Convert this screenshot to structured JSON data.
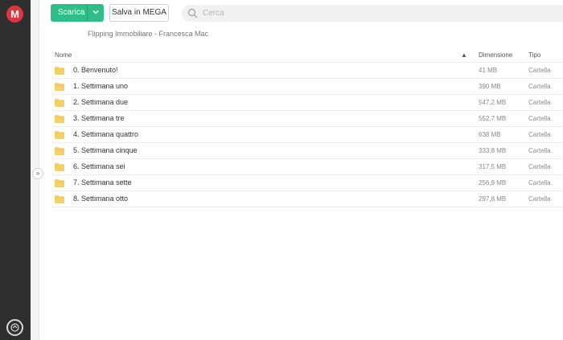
{
  "toolbar": {
    "download_label": "Scarica",
    "save_label": "Salva in MEGA"
  },
  "search": {
    "placeholder": "Cerca",
    "value": ""
  },
  "breadcrumb": "Flipping Immobiliare - Francesca Mac",
  "logo_letter": "M",
  "table": {
    "headers": {
      "name": "Nome",
      "sort_arrow": "▲",
      "size": "Dimensione",
      "type": "Tipo"
    },
    "rows": [
      {
        "name": "0. Benvenuto!",
        "size": "41 MB",
        "type": "Cartella"
      },
      {
        "name": "1. Settimana uno",
        "size": "390 MB",
        "type": "Cartella"
      },
      {
        "name": "2. Settimana due",
        "size": "547,2 MB",
        "type": "Cartella"
      },
      {
        "name": "3. Settimana tre",
        "size": "552,7 MB",
        "type": "Cartella"
      },
      {
        "name": "4. Settimana quattro",
        "size": "638 MB",
        "type": "Cartella"
      },
      {
        "name": "5. Settimana cinque",
        "size": "333,8 MB",
        "type": "Cartella"
      },
      {
        "name": "6. Settimana sei",
        "size": "317,5 MB",
        "type": "Cartella"
      },
      {
        "name": "7. Settimana sette",
        "size": "256,9 MB",
        "type": "Cartella"
      },
      {
        "name": "8. Settimana otto",
        "size": "297,8 MB",
        "type": "Cartella"
      }
    ]
  },
  "colors": {
    "accent": "#2dbf87",
    "brand": "#e0353f",
    "folder": "#f5cf6b"
  }
}
